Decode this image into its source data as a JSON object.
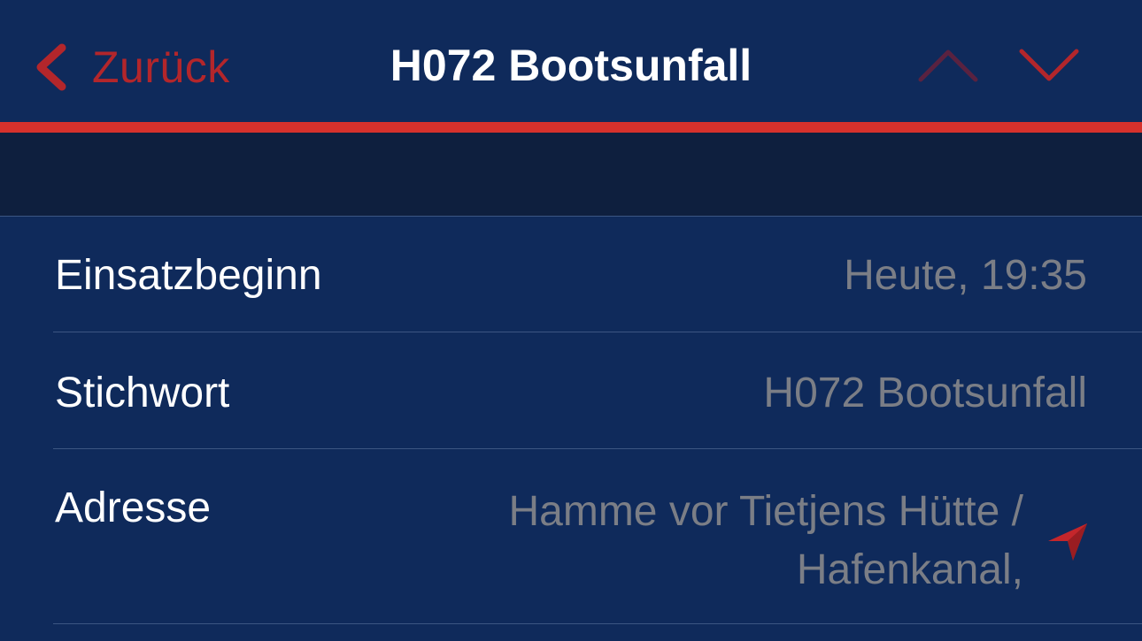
{
  "navbar": {
    "back_label": "Zurück",
    "title": "H072 Bootsunfall",
    "prev_icon": "chevron-up-icon",
    "next_icon": "chevron-down-icon",
    "prev_enabled": false,
    "next_enabled": true
  },
  "colors": {
    "background": "#0f2a5b",
    "accent": "#d6312c",
    "back_tint": "#b3262b",
    "section_header": "#0e1f3e",
    "label_text": "#ffffff",
    "value_text": "#7b7e86"
  },
  "details": {
    "rows": [
      {
        "label": "Einsatzbeginn",
        "value": "Heute, 19:35"
      },
      {
        "label": "Stichwort",
        "value": "H072 Bootsunfall"
      },
      {
        "label": "Adresse",
        "value": "Hamme vor Tietjens Hütte / Hafenkanal,",
        "icon": "location-arrow-icon"
      }
    ]
  }
}
